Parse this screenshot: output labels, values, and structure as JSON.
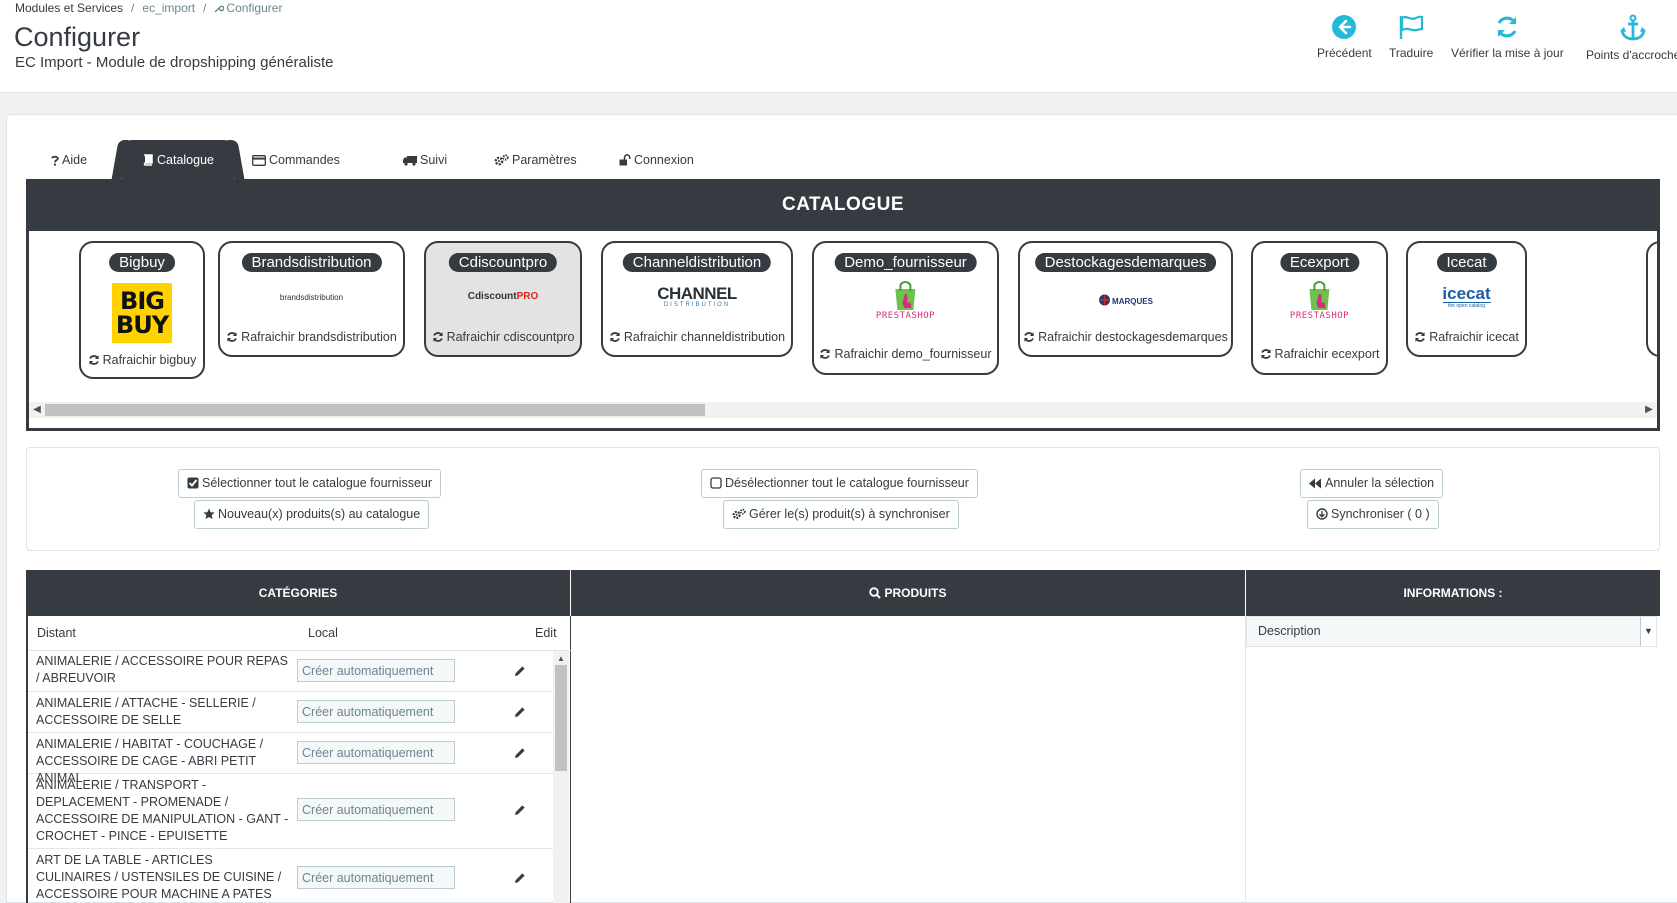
{
  "breadcrumb": {
    "items": [
      "Modules et Services",
      "ec_import",
      "Configurer"
    ],
    "separator": "/"
  },
  "page": {
    "title": "Configurer",
    "subtitle": "EC Import - Module de dropshipping généraliste"
  },
  "toolbar": {
    "back": "Précédent",
    "translate": "Traduire",
    "check_update": "Vérifier la mise à jour",
    "hooks": "Points d'accroche"
  },
  "tabs": [
    {
      "label": "Aide",
      "icon": "question-icon"
    },
    {
      "label": "Catalogue",
      "icon": "book-icon"
    },
    {
      "label": "Commandes",
      "icon": "credit-card-icon"
    },
    {
      "label": "Suivi",
      "icon": "truck-icon"
    },
    {
      "label": "Paramètres",
      "icon": "cogs-icon"
    },
    {
      "label": "Connexion",
      "icon": "unlock-icon"
    }
  ],
  "catalogue": {
    "title": "CATALOGUE",
    "suppliers": [
      {
        "name": "Bigbuy",
        "refresh": "Rafraichir bigbuy",
        "logo": "BIG BUY"
      },
      {
        "name": "Brandsdistribution",
        "refresh": "Rafraichir brandsdistribution",
        "logo": "brandsdistribution"
      },
      {
        "name": "Cdiscountpro",
        "refresh": "Rafraichir cdiscountpro",
        "logo": "Cdiscount",
        "logo2": "PRO"
      },
      {
        "name": "Channeldistribution",
        "refresh": "Rafraichir channeldistribution",
        "logo": "CHANNEL",
        "logo2": "DISTRIBUTION"
      },
      {
        "name": "Demo_fournisseur",
        "refresh": "Rafraichir demo_fournisseur",
        "logo": "PRESTASHOP"
      },
      {
        "name": "Destockagesdemarques",
        "refresh": "Rafraichir destockagesdemarques",
        "logo": "MARQUES"
      },
      {
        "name": "Ecexport",
        "refresh": "Rafraichir ecexport",
        "logo": "PRESTASHOP"
      },
      {
        "name": "Icecat",
        "refresh": "Rafraichir icecat",
        "logo": "icecat",
        "logo2": "the open catalog"
      }
    ]
  },
  "actions": {
    "select_all": "Sélectionner tout le catalogue fournisseur",
    "new_products": "Nouveau(x) produits(s) au catalogue",
    "deselect_all": "Désélectionner tout le catalogue fournisseur",
    "manage_sync": "Gérer le(s) produit(s) à synchroniser",
    "cancel_selection": "Annuler la sélection",
    "synchronize": "Synchroniser ( 0 )"
  },
  "grid": {
    "categories_title": "CATÉGORIES",
    "products_title": "PRODUITS",
    "info_title": "INFORMATIONS :",
    "col_distant": "Distant",
    "col_local": "Local",
    "col_edit": "Edit",
    "info_select": "Description",
    "rows": [
      {
        "distant": "ANIMALERIE / ACCESSOIRE POUR REPAS / ABREUVOIR",
        "local": "Créer automatiquement"
      },
      {
        "distant": "ANIMALERIE / ATTACHE - SELLERIE / ACCESSOIRE DE SELLE",
        "local": "Créer automatiquement"
      },
      {
        "distant": "ANIMALERIE / HABITAT - COUCHAGE / ACCESSOIRE DE CAGE - ABRI PETIT ANIMAL",
        "local": "Créer automatiquement"
      },
      {
        "distant": "ANIMALERIE / TRANSPORT - DEPLACEMENT - PROMENADE / ACCESSOIRE DE MANIPULATION - GANT - CROCHET - PINCE - EPUISETTE",
        "local": "Créer automatiquement"
      },
      {
        "distant": "ART DE LA TABLE - ARTICLES CULINAIRES / USTENSILES DE CUISINE / ACCESSOIRE POUR MACHINE A PATES",
        "local": "Créer automatiquement"
      }
    ]
  },
  "colors": {
    "dark": "#363a41",
    "accent": "#25b9d7",
    "bigbuy_yellow": "#ffd200",
    "prestashop_green": "#6cc24a",
    "cdiscount_red": "#e2231a"
  }
}
